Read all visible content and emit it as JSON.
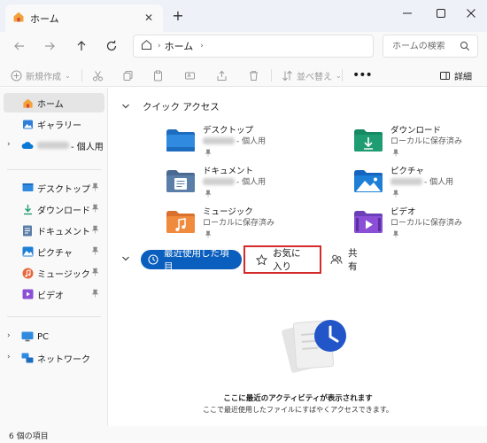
{
  "tab": {
    "title": "ホーム"
  },
  "address": {
    "path": "ホーム",
    "search_placeholder": "ホームの検索"
  },
  "toolbar": {
    "new_label": "新規作成",
    "sort_label": "並べ替え",
    "details_label": "詳細"
  },
  "sidebar": {
    "home": "ホーム",
    "gallery": "ギャラリー",
    "personal_suffix": "- 個人用",
    "desktop": "デスクトップ",
    "downloads": "ダウンロード",
    "documents": "ドキュメント",
    "pictures": "ピクチャ",
    "music": "ミュージック",
    "videos": "ビデオ",
    "pc": "PC",
    "network": "ネットワーク"
  },
  "quick_access": {
    "heading": "クイック アクセス",
    "items": [
      {
        "name": "デスクトップ",
        "sub": "- 個人用"
      },
      {
        "name": "ダウンロード",
        "sub": "ローカルに保存済み"
      },
      {
        "name": "ドキュメント",
        "sub": "- 個人用"
      },
      {
        "name": "ピクチャ",
        "sub": "- 個人用"
      },
      {
        "name": "ミュージック",
        "sub": "ローカルに保存済み"
      },
      {
        "name": "ビデオ",
        "sub": "ローカルに保存済み"
      }
    ]
  },
  "filters": {
    "recent": "最近使用した項目",
    "favorites": "お気に入り",
    "shared": "共有"
  },
  "empty_state": {
    "title": "ここに最近のアクティビティが表示されます",
    "subtitle": "ここで最近使用したファイルにすばやくアクセスできます。"
  },
  "status": {
    "item_count": "6 個の項目"
  },
  "colors": {
    "accent": "#0a5ebd",
    "highlight": "#d42a2a",
    "folder_blue": "#2f8ae0",
    "folder_green": "#1f9c72"
  }
}
